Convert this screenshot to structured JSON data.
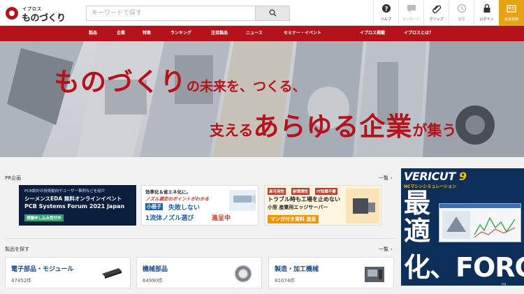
{
  "header": {
    "logo_small": "イプロス",
    "logo_main": "ものづくり",
    "search_placeholder": "キーワードで探す",
    "utilities": [
      {
        "label": "ヘルプ",
        "icon": "help-icon",
        "enabled": true
      },
      {
        "label": "メッセージ",
        "icon": "message-icon",
        "enabled": false
      },
      {
        "label": "クリップ",
        "icon": "clip-icon",
        "enabled": true
      },
      {
        "label": "履歴",
        "icon": "history-icon",
        "enabled": false
      },
      {
        "label": "ログイン",
        "icon": "lock-icon",
        "enabled": true
      },
      {
        "label": "会員登録",
        "icon": "member-card-icon",
        "enabled": true
      }
    ]
  },
  "nav": {
    "items": [
      "製品",
      "企業",
      "特集",
      "ランキング",
      "注目製品",
      "ニュース",
      "セミナー・イベント",
      "イプロス掲載",
      "イプロスとは？"
    ]
  },
  "hero": {
    "line1_big": "ものづくり",
    "line1_rest": "の未来を、つくる、",
    "line2_pre": "支える",
    "line2_big": "あらゆる企業",
    "line2_mid": "が集う"
  },
  "pr_section": {
    "title": "PR企画",
    "more": "一覧",
    "banners": [
      {
        "line1": "PCB設計の技術動向やユーザー事例などを紹介",
        "line2": "シーメンスEDA 無料オンラインイベント",
        "line3": "PCB Systems Forum 2021 Japan",
        "line4": "視聴申し込み受付中"
      },
      {
        "line1": "効率化＆省エネ化に。",
        "line2": "ノズル選定のポイントがわかる",
        "line3_tag": "小冊子",
        "line3": "失敗しない",
        "line4": "1流体ノズル選び",
        "line4_tag": "進呈中"
      },
      {
        "tags": [
          "高可用性",
          "耐環境性",
          "IT知識不要"
        ],
        "line2": "トラブル時も工場を止めない",
        "line3": "小型 産業用エッジサーバー",
        "line4": "マンガ付き資料 進呈"
      }
    ]
  },
  "products_section": {
    "title": "製品を探す",
    "more": "一覧",
    "categories": [
      {
        "name": "電子部品・モジュール",
        "count": "47452件"
      },
      {
        "name": "機械部品",
        "count": "64990件"
      },
      {
        "name": "製造・加工機械",
        "count": "81074件"
      }
    ]
  },
  "ad": {
    "brand": "VERICUT",
    "version": "9",
    "subtitle": "NCマシンシミュレーション",
    "big1": "最",
    "big2": "適",
    "big3": "化、FORCE",
    "pr_label": "PR"
  }
}
